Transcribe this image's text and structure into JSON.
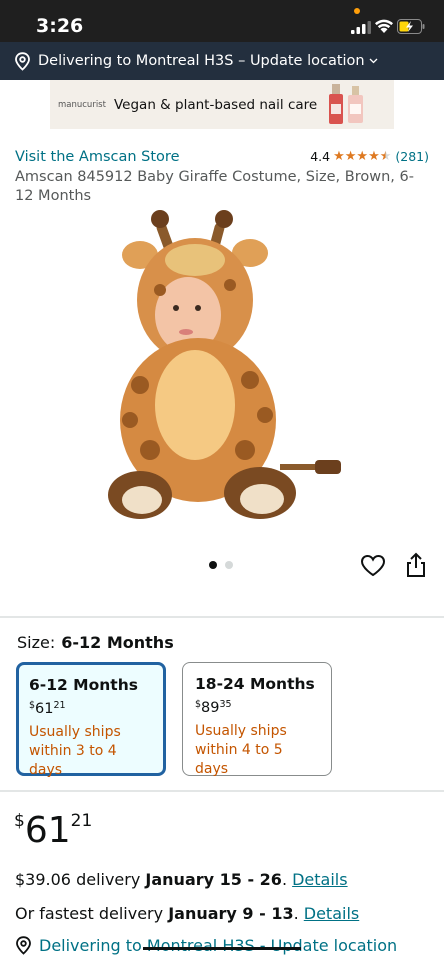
{
  "status": {
    "time": "3:26"
  },
  "location_bar": {
    "text": "Delivering to Montreal H3S – Update location"
  },
  "ad": {
    "brand": "manucurist",
    "tagline": "Vegan & plant-based nail care"
  },
  "product": {
    "store_link": "Visit the Amscan Store",
    "rating": "4.4",
    "rating_count": "(281)",
    "title": "Amscan 845912 Baby Giraffe Costume, Size, Brown, 6-12 Months",
    "image_count": 2,
    "active_image": 1
  },
  "size": {
    "label": "Size:",
    "selected": "6-12 Months",
    "options": [
      {
        "name": "6-12 Months",
        "currency": "$",
        "whole": "61",
        "frac": "21",
        "ship": "Usually ships within 3 to 4 days"
      },
      {
        "name": "18-24 Months",
        "currency": "$",
        "whole": "89",
        "frac": "35",
        "ship": "Usually ships within 4 to 5 days"
      }
    ]
  },
  "price": {
    "currency": "$",
    "whole": "61",
    "frac": "21"
  },
  "delivery": {
    "standard_prefix": "$39.06 delivery ",
    "standard_dates": "January 15 - 26",
    "standard_sep": ". ",
    "standard_link": "Details",
    "fastest_prefix": "Or fastest delivery ",
    "fastest_dates": "January 9 - 13",
    "fastest_sep": ". ",
    "fastest_link": "Details",
    "bottom_text": "Delivering to Montreal H3S - Update location"
  },
  "colors": {
    "link": "#007185",
    "nav": "#232f3e",
    "star": "#de7921",
    "ship": "#c45500",
    "selected_border": "#2162a1"
  },
  "icons": [
    "signal-icon",
    "wifi-icon",
    "battery-charging-icon",
    "location-pin-icon",
    "chevron-down-icon",
    "heart-icon",
    "share-icon",
    "star-icon"
  ]
}
